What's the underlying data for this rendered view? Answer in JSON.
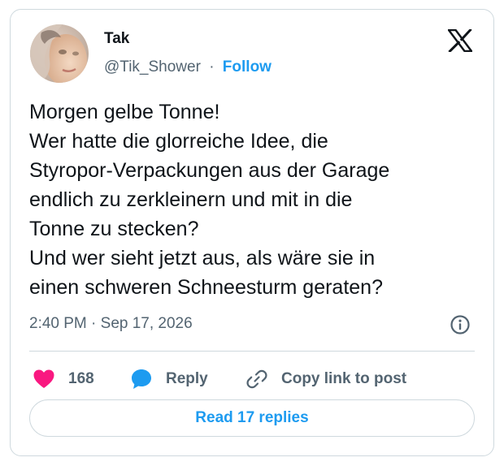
{
  "author": {
    "display_name": "Tak",
    "handle": "@Tik_Shower",
    "separator": "·",
    "follow_label": "Follow",
    "avatar_icon": "profile-photo"
  },
  "brand": {
    "logo_icon": "x-logo",
    "accent_color": "#1d9bf0",
    "like_color": "#f91880"
  },
  "tweet": {
    "lines": [
      "Morgen gelbe Tonne!",
      "Wer hatte die glorreiche Idee, die",
      "Styropor-Verpackungen aus der Garage",
      "endlich zu zerkleinern und mit in die",
      "Tonne zu stecken?",
      "Und wer sieht jetzt aus, als wäre sie in",
      "einen schweren Schneesturm geraten?"
    ],
    "timestamp": "2:40 PM · Sep 17, 2026"
  },
  "actions": {
    "like_count": "168",
    "reply_label": "Reply",
    "copy_label": "Copy link to post",
    "read_replies_label": "Read 17 replies"
  }
}
